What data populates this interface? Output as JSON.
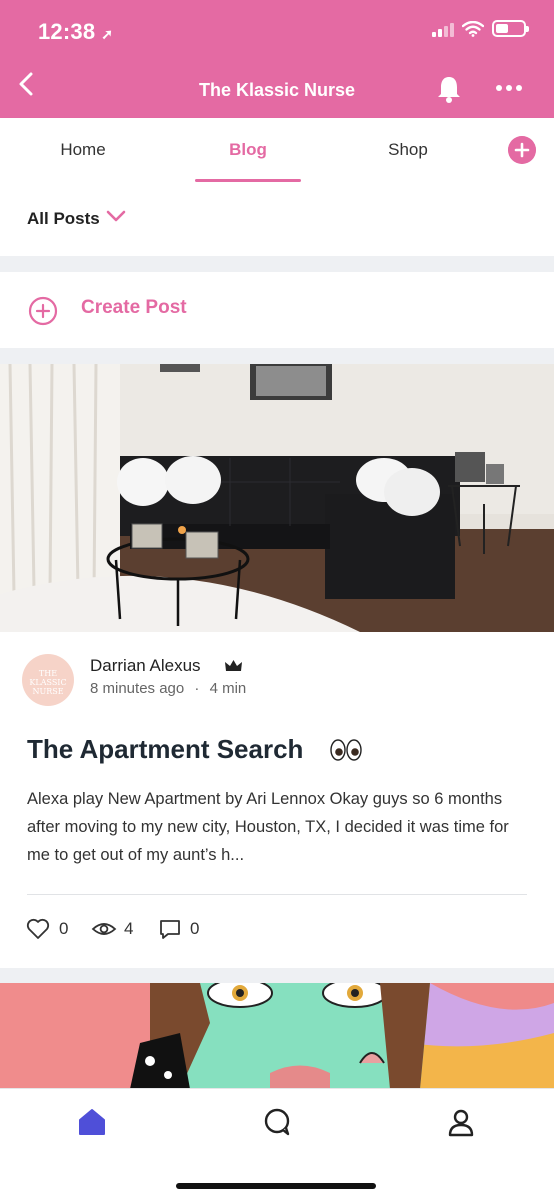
{
  "status_bar": {
    "time": "12:38",
    "location_icon": "location-arrow-icon",
    "signal_bars": 2,
    "battery_level": 0.35
  },
  "header": {
    "title": "The Klassic Nurse",
    "back_icon": "chevron-left-icon",
    "bell_icon": "bell-icon",
    "more_icon": "more-dots-icon"
  },
  "tabs": [
    {
      "label": "Home",
      "active": false
    },
    {
      "label": "Blog",
      "active": true
    },
    {
      "label": "Shop",
      "active": false
    }
  ],
  "filter": {
    "label": "All Posts"
  },
  "create_post": {
    "label": "Create Post"
  },
  "post": {
    "author": "Darrian Alexus",
    "avatar_text": "THE KLASSIC NURSE",
    "time_ago": "8 minutes ago",
    "separator": "·",
    "read_time": "4 min",
    "title": "The Apartment Search",
    "title_emoji": "eyes-icon",
    "excerpt": "Alexa play New Apartment by Ari Lennox Okay guys so 6 months after moving to my new city, Houston, TX, I decided it was time for me to get out of my aunt’s h...",
    "likes": "0",
    "views": "4",
    "comments": "0"
  },
  "colors": {
    "brand": "#e46aa3",
    "nav_active": "#4f4fd8",
    "divider": "#eef0f3"
  },
  "bottom_nav": [
    {
      "icon": "home-icon",
      "active": true
    },
    {
      "icon": "chat-bubble-icon",
      "active": false
    },
    {
      "icon": "profile-icon",
      "active": false
    }
  ]
}
